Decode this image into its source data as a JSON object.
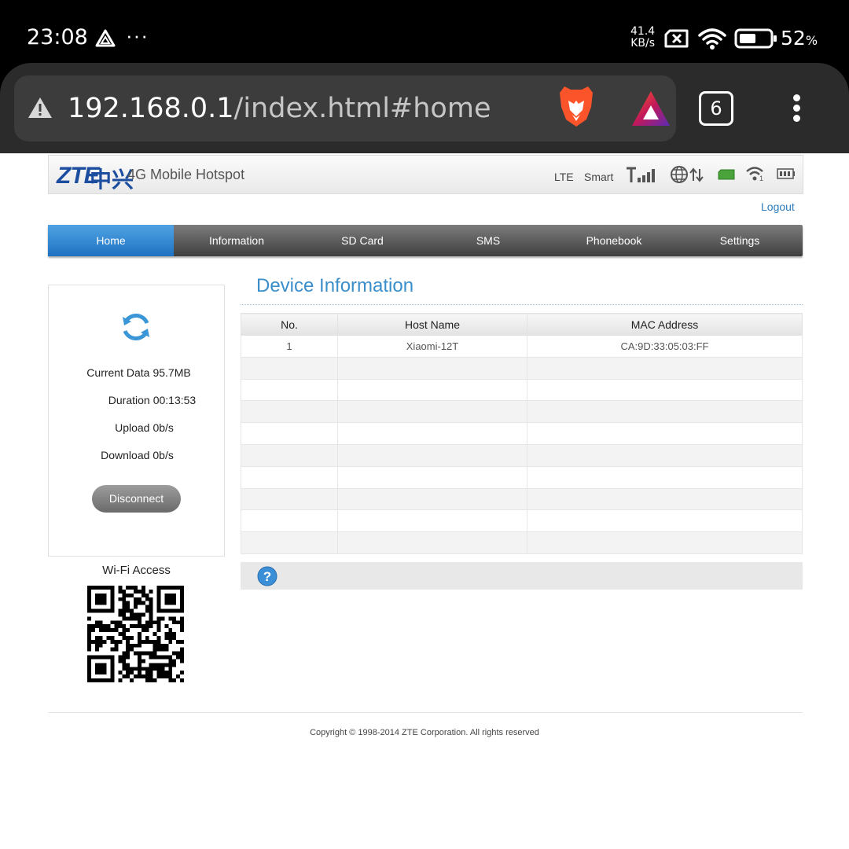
{
  "status_bar": {
    "time": "23:08",
    "net_speed_value": "41.4",
    "net_speed_unit": "KB/s",
    "battery_percent": "52",
    "battery_percent_sign": "%"
  },
  "browser": {
    "url_host": "192.168.0.1",
    "url_path": "/index.html#home",
    "tab_count": "6"
  },
  "router": {
    "brand": "ZTE",
    "brand_cn": "中兴",
    "product": "4G Mobile Hotspot",
    "network_type": "LTE",
    "carrier": "Smart",
    "wifi_clients": "1",
    "logout": "Logout"
  },
  "nav": [
    {
      "label": "Home",
      "active": true
    },
    {
      "label": "Information"
    },
    {
      "label": "SD Card"
    },
    {
      "label": "SMS"
    },
    {
      "label": "Phonebook"
    },
    {
      "label": "Settings"
    }
  ],
  "connection": {
    "current_data_label": "Current Data",
    "current_data": "95.7MB",
    "duration_label": "Duration",
    "duration": "00:13:53",
    "upload_label": "Upload",
    "upload": "0b/s",
    "download_label": "Download",
    "download": "0b/s",
    "disconnect": "Disconnect",
    "wifi_access": "Wi-Fi Access"
  },
  "device_info": {
    "title": "Device Information",
    "columns": [
      "No.",
      "Host Name",
      "MAC Address"
    ],
    "rows": [
      [
        "1",
        "Xiaomi-12T",
        "CA:9D:33:05:03:FF"
      ]
    ],
    "empty_rows": 9
  },
  "footer": {
    "copyright": "Copyright © 1998-2014 ZTE Corporation. All rights reserved"
  },
  "colors": {
    "accent_blue": "#3b8ec9",
    "nav_active": "#1f72c2",
    "brand_blue": "#1c4d9e"
  }
}
